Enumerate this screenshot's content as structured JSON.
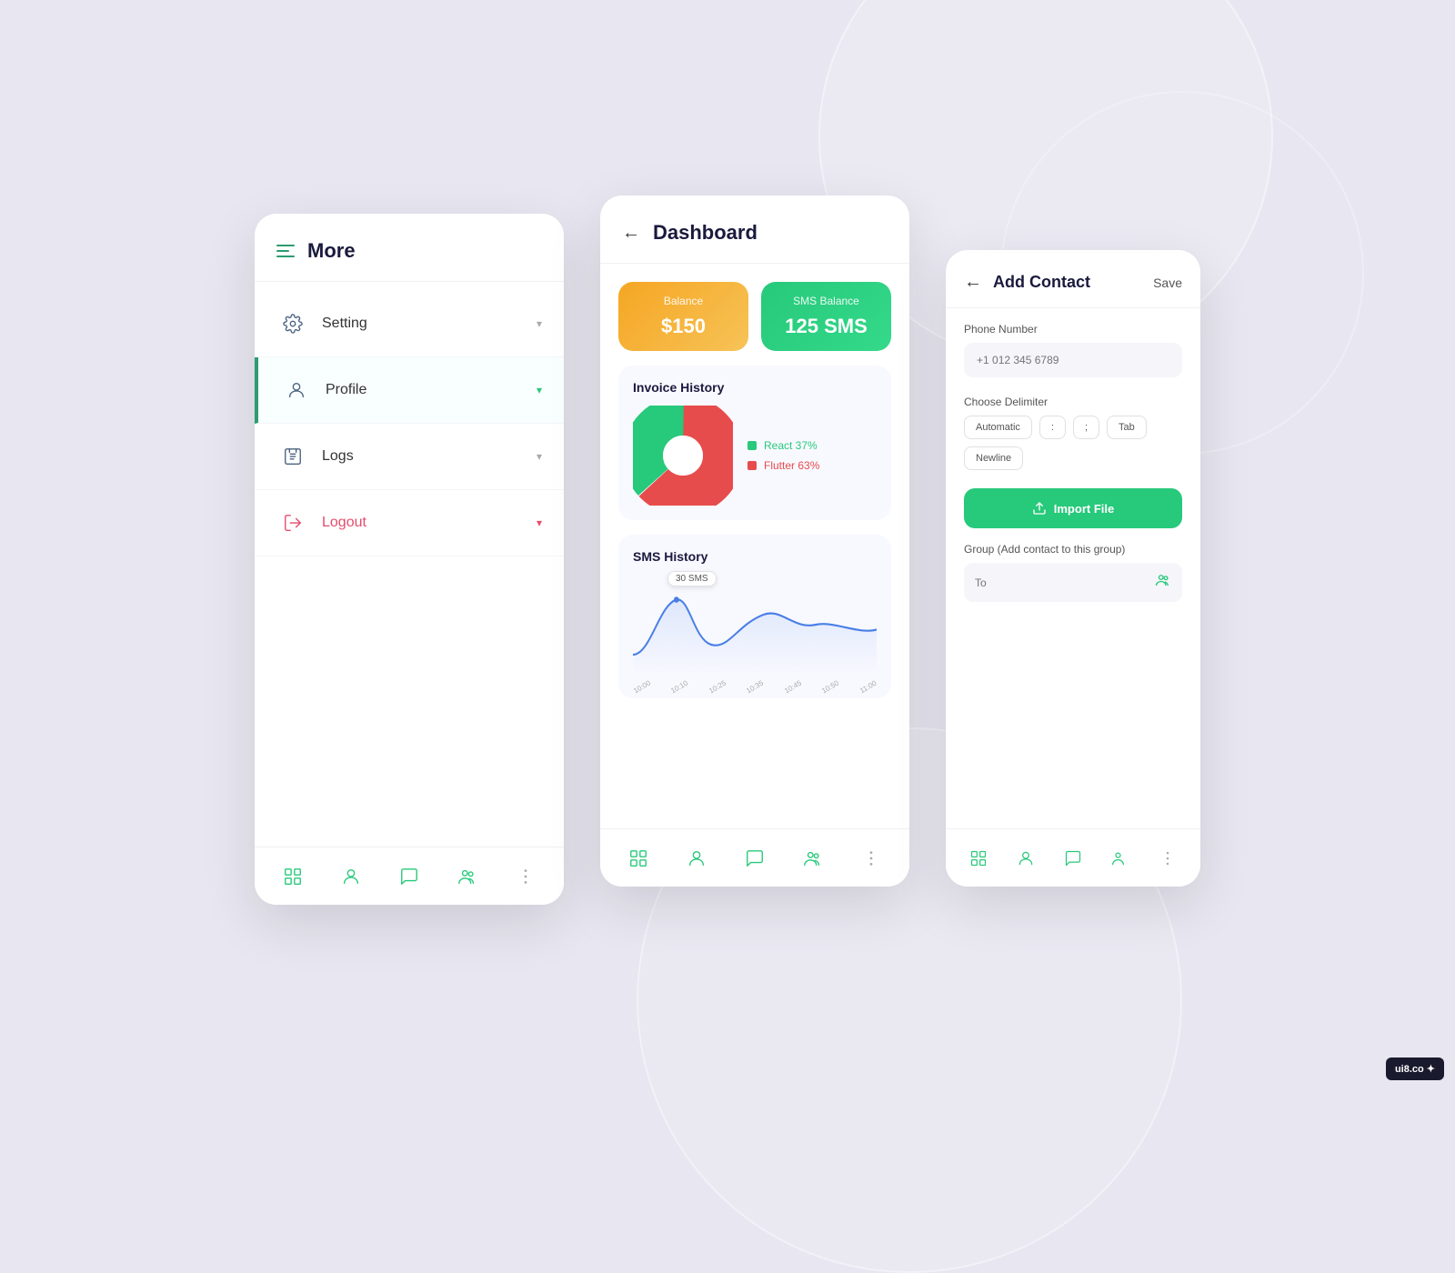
{
  "background": {
    "color": "#e8e6f0"
  },
  "screen_more": {
    "title": "More",
    "menu_items": [
      {
        "id": "setting",
        "label": "Setting",
        "icon": "gear",
        "active": false,
        "chevron": "▾"
      },
      {
        "id": "profile",
        "label": "Profile",
        "icon": "user",
        "active": true,
        "chevron": "▾"
      },
      {
        "id": "logs",
        "label": "Logs",
        "icon": "log",
        "active": false,
        "chevron": "▾"
      },
      {
        "id": "logout",
        "label": "Logout",
        "icon": "logout",
        "active": false,
        "chevron": "▾"
      }
    ],
    "nav_icons": [
      "grid",
      "person",
      "chat",
      "group",
      "more"
    ]
  },
  "screen_dashboard": {
    "title": "Dashboard",
    "balance_card": {
      "label": "Balance",
      "value": "$150"
    },
    "sms_balance_card": {
      "label": "SMS Balance",
      "value": "125 SMS"
    },
    "invoice": {
      "title": "Invoice History",
      "legend": [
        {
          "label": "React 37%",
          "color": "green",
          "value": 37
        },
        {
          "label": "Flutter 63%",
          "color": "red",
          "value": 63
        }
      ]
    },
    "sms_history": {
      "title": "SMS History",
      "badge": "30 SMS",
      "x_labels": [
        "10:00",
        "10:10",
        "10:25",
        "10:35",
        "10:45",
        "10:50",
        "11:00"
      ]
    }
  },
  "screen_contact": {
    "title": "Add Contact",
    "save_label": "Save",
    "phone_number_label": "Phone Number",
    "phone_placeholder": "+1 012 345 6789",
    "delimiter_label": "Choose Delimiter",
    "delimiter_options": [
      "Automatic",
      ":",
      ";",
      "Tab",
      "Newline"
    ],
    "import_label": "Import File",
    "group_label": "Group (Add contact to this group)",
    "group_placeholder": "To"
  },
  "watermark": "ui8.co ✦"
}
